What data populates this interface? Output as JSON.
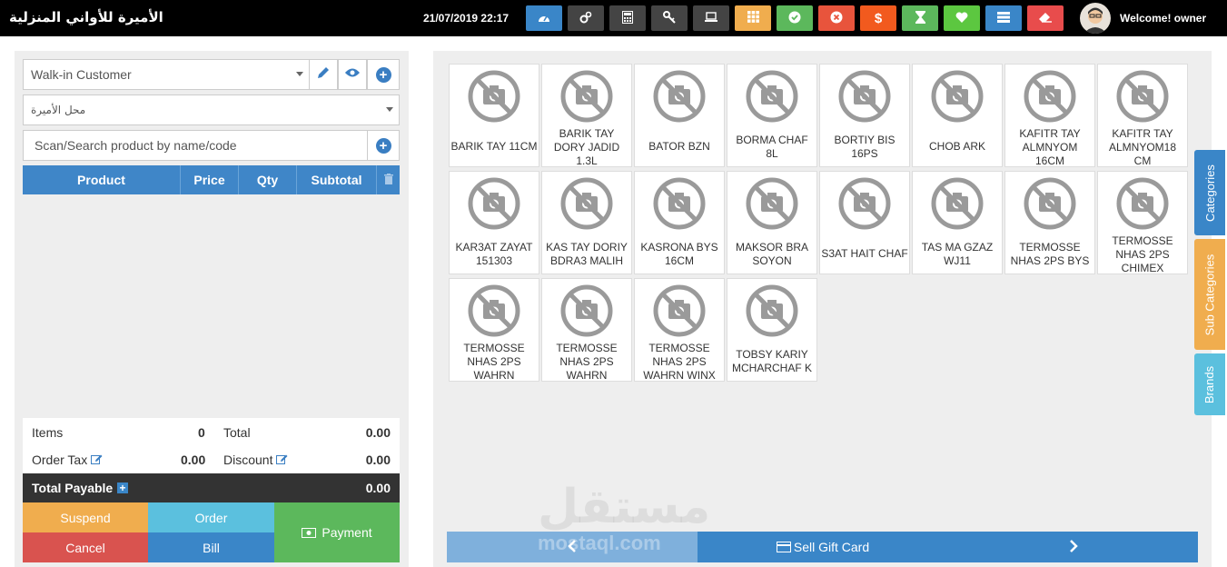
{
  "header": {
    "shop_name": "الأميرة للأواني المنزلية",
    "datetime": "21/07/2019 22:17",
    "welcome": "Welcome! owner",
    "buttons": [
      {
        "icon": "dashboard-icon",
        "color": "#3a86c8"
      },
      {
        "icon": "settings-icon",
        "color": "#444444"
      },
      {
        "icon": "calculator-icon",
        "color": "#444444"
      },
      {
        "icon": "key-icon",
        "color": "#444444"
      },
      {
        "icon": "laptop-icon",
        "color": "#444444"
      },
      {
        "icon": "grid-icon",
        "color": "#f0ad4e"
      },
      {
        "icon": "check-circle-icon",
        "color": "#5cb85c"
      },
      {
        "icon": "times-circle-icon",
        "color": "#e8543c"
      },
      {
        "icon": "dollar-icon",
        "color": "#f25a1e"
      },
      {
        "icon": "hourglass-icon",
        "color": "#5cb85c"
      },
      {
        "icon": "heart-icon",
        "color": "#5cc740"
      },
      {
        "icon": "list-icon",
        "color": "#3a86c8"
      },
      {
        "icon": "eraser-icon",
        "color": "#e84c4c"
      }
    ]
  },
  "customer": {
    "selected": "Walk-in Customer"
  },
  "warehouse": {
    "selected": "محل الأميرة"
  },
  "search": {
    "placeholder": "Scan/Search product by name/code"
  },
  "table": {
    "columns": [
      "Product",
      "Price",
      "Qty",
      "Subtotal"
    ]
  },
  "totals": {
    "items_label": "Items",
    "items_value": "0",
    "total_label": "Total",
    "total_value": "0.00",
    "tax_label": "Order Tax",
    "tax_value": "0.00",
    "discount_label": "Discount",
    "discount_value": "0.00",
    "payable_label": "Total Payable",
    "payable_value": "0.00"
  },
  "actions": {
    "suspend": "Suspend",
    "order": "Order",
    "payment": "Payment",
    "cancel": "Cancel",
    "bill": "Bill"
  },
  "products": [
    {
      "name": "BARIK TAY 11CM"
    },
    {
      "name": "BARIK TAY DORY JADID 1.3L"
    },
    {
      "name": "BATOR BZN"
    },
    {
      "name": "BORMA CHAF 8L"
    },
    {
      "name": "BORTIY BIS 16PS"
    },
    {
      "name": "CHOB ARK"
    },
    {
      "name": "KAFITR TAY ALMNYOM 16CM"
    },
    {
      "name": "KAFITR TAY ALMNYOM18 CM"
    },
    {
      "name": "KAR3AT ZAYAT 151303"
    },
    {
      "name": "KAS TAY DORIY BDRA3 MALIH"
    },
    {
      "name": "KASRONA BYS 16CM"
    },
    {
      "name": "MAKSOR BRA SOYON"
    },
    {
      "name": "S3AT HAIT CHAF"
    },
    {
      "name": "TAS MA GZAZ WJ11"
    },
    {
      "name": "TERMOSSE NHAS 2PS BYS"
    },
    {
      "name": "TERMOSSE NHAS 2PS CHIMEX"
    },
    {
      "name": "TERMOSSE NHAS 2PS WAHRN"
    },
    {
      "name": "TERMOSSE NHAS 2PS WAHRN"
    },
    {
      "name": "TERMOSSE NHAS 2PS WAHRN WINX"
    },
    {
      "name": "TOBSY KARIY MCHARCHAF K"
    }
  ],
  "side_tabs": {
    "categories": "Categories",
    "subcategories": "Sub Categories",
    "brands": "Brands"
  },
  "pager": {
    "gift_card": "Sell Gift Card"
  },
  "watermark": {
    "arabic": "مستقل",
    "latin": "mostaql.com"
  }
}
